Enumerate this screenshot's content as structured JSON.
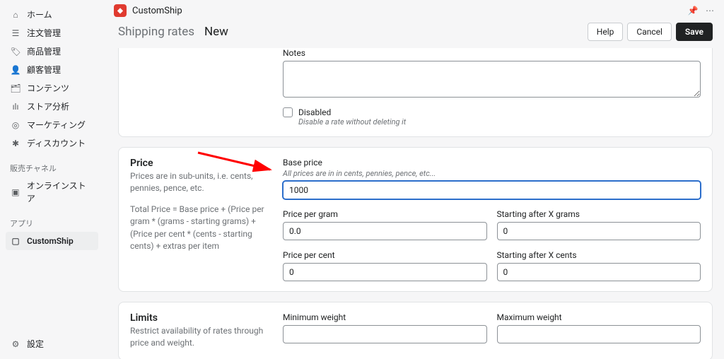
{
  "sidebar": {
    "nav": [
      {
        "icon": "⌂",
        "label": "ホーム"
      },
      {
        "icon": "☰",
        "label": "注文管理"
      },
      {
        "icon": "🏷",
        "label": "商品管理"
      },
      {
        "icon": "👤",
        "label": "顧客管理"
      },
      {
        "icon": "🗂",
        "label": "コンテンツ"
      },
      {
        "icon": "ılı",
        "label": "ストア分析"
      },
      {
        "icon": "◎",
        "label": "マーケティング"
      },
      {
        "icon": "✱",
        "label": "ディスカウント"
      }
    ],
    "channels_label": "販売チャネル",
    "channels": [
      {
        "icon": "▣",
        "label": "オンラインストア"
      }
    ],
    "apps_label": "アプリ",
    "apps": [
      {
        "icon": "▢",
        "label": "CustomShip"
      }
    ],
    "settings": {
      "icon": "⚙",
      "label": "設定"
    }
  },
  "appbar": {
    "title": "CustomShip"
  },
  "page": {
    "title": "Shipping rates",
    "status": "New"
  },
  "buttons": {
    "help": "Help",
    "cancel": "Cancel",
    "save": "Save"
  },
  "notes": {
    "label": "Notes",
    "disabled_label": "Disabled",
    "disabled_desc": "Disable a rate without deleting it"
  },
  "price": {
    "heading": "Price",
    "desc": "Prices are in sub-units, i.e. cents, pennies, pence, etc.",
    "formula": "Total Price = Base price + (Price per gram * (grams - starting grams) + (Price per cent * (cents - starting cents) + extras per item",
    "base_label": "Base price",
    "base_sub": "All prices are in in cents, pennies, pence, etc...",
    "base_value": "1000",
    "ppg_label": "Price per gram",
    "ppg_value": "0.0",
    "sag_label": "Starting after X grams",
    "sag_value": "0",
    "ppc_label": "Price per cent",
    "ppc_value": "0",
    "sac_label": "Starting after X cents",
    "sac_value": "0"
  },
  "limits": {
    "heading": "Limits",
    "desc": "Restrict availability of rates through price and weight.",
    "minw_label": "Minimum weight",
    "maxw_label": "Maximum weight"
  }
}
